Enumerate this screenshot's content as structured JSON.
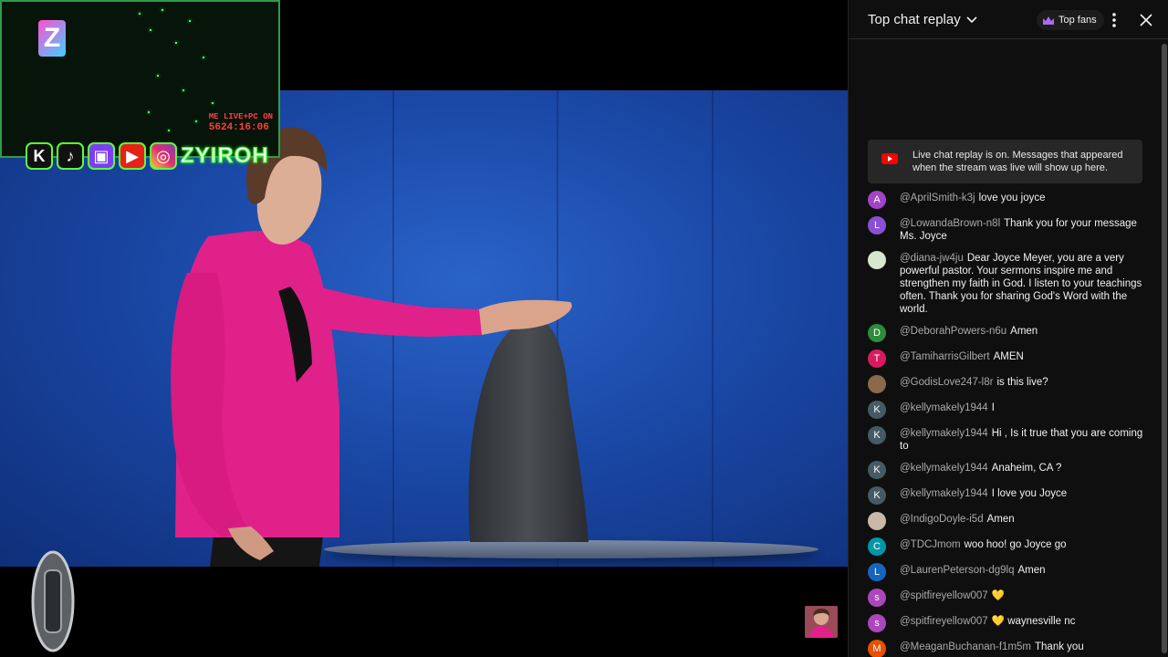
{
  "overlay": {
    "cam_badge_line1": "ME LIVE+PC ON",
    "cam_timer": "5624:16:06",
    "logo_letter": "Z",
    "social": [
      "K",
      "♪",
      "▣",
      "▶",
      "◎"
    ],
    "handle": "ZYIROH"
  },
  "chat": {
    "title": "Top chat replay",
    "top_fans_label": "Top fans",
    "replay_notice": "Live chat replay is on. Messages that appeared when the stream was live will show up here.",
    "messages": [
      {
        "avatar": "A",
        "color": "#a044c8",
        "author": "@AprilSmith-k3j",
        "text": "love you joyce"
      },
      {
        "avatar": "L",
        "color": "#8b4fd6",
        "author": "@LowandaBrown-n8l",
        "text": "Thank you for your message Ms. Joyce"
      },
      {
        "avatar": "",
        "color": "#d8e6d0",
        "author": "@diana-jw4ju",
        "text": "Dear Joyce Meyer, you are a very powerful pastor. Your sermons inspire me and strengthen my faith in God. I listen to your teachings often. Thank you for sharing God's Word with the world."
      },
      {
        "avatar": "D",
        "color": "#2e8b3a",
        "author": "@DeborahPowers-n6u",
        "text": "Amen"
      },
      {
        "avatar": "T",
        "color": "#d81b60",
        "author": "@TamiharrisGilbert",
        "text": "AMEN"
      },
      {
        "avatar": "",
        "color": "#8a6a4a",
        "author": "@GodisLove247-l8r",
        "text": "is this live?"
      },
      {
        "avatar": "K",
        "color": "#455a64",
        "author": "@kellymakely1944",
        "text": "I"
      },
      {
        "avatar": "K",
        "color": "#455a64",
        "author": "@kellymakely1944",
        "text": "Hi , Is it true that you are coming to"
      },
      {
        "avatar": "K",
        "color": "#455a64",
        "author": "@kellymakely1944",
        "text": "Anaheim, CA ?"
      },
      {
        "avatar": "K",
        "color": "#455a64",
        "author": "@kellymakely1944",
        "text": "I love you Joyce"
      },
      {
        "avatar": "",
        "color": "#c9b8a8",
        "author": "@IndigoDoyle-i5d",
        "text": "Amen"
      },
      {
        "avatar": "C",
        "color": "#0097a7",
        "author": "@TDCJmom",
        "text": "woo hoo! go Joyce go"
      },
      {
        "avatar": "L",
        "color": "#1565c0",
        "author": "@LaurenPeterson-dg9lq",
        "text": "Amen"
      },
      {
        "avatar": "s",
        "color": "#ab47bc",
        "author": "@spitfireyellow007",
        "text": "💛"
      },
      {
        "avatar": "s",
        "color": "#ab47bc",
        "author": "@spitfireyellow007",
        "text": "💛 waynesville nc"
      },
      {
        "avatar": "M",
        "color": "#e65100",
        "author": "@MeaganBuchanan-f1m5m",
        "text": "Thank you"
      }
    ]
  }
}
